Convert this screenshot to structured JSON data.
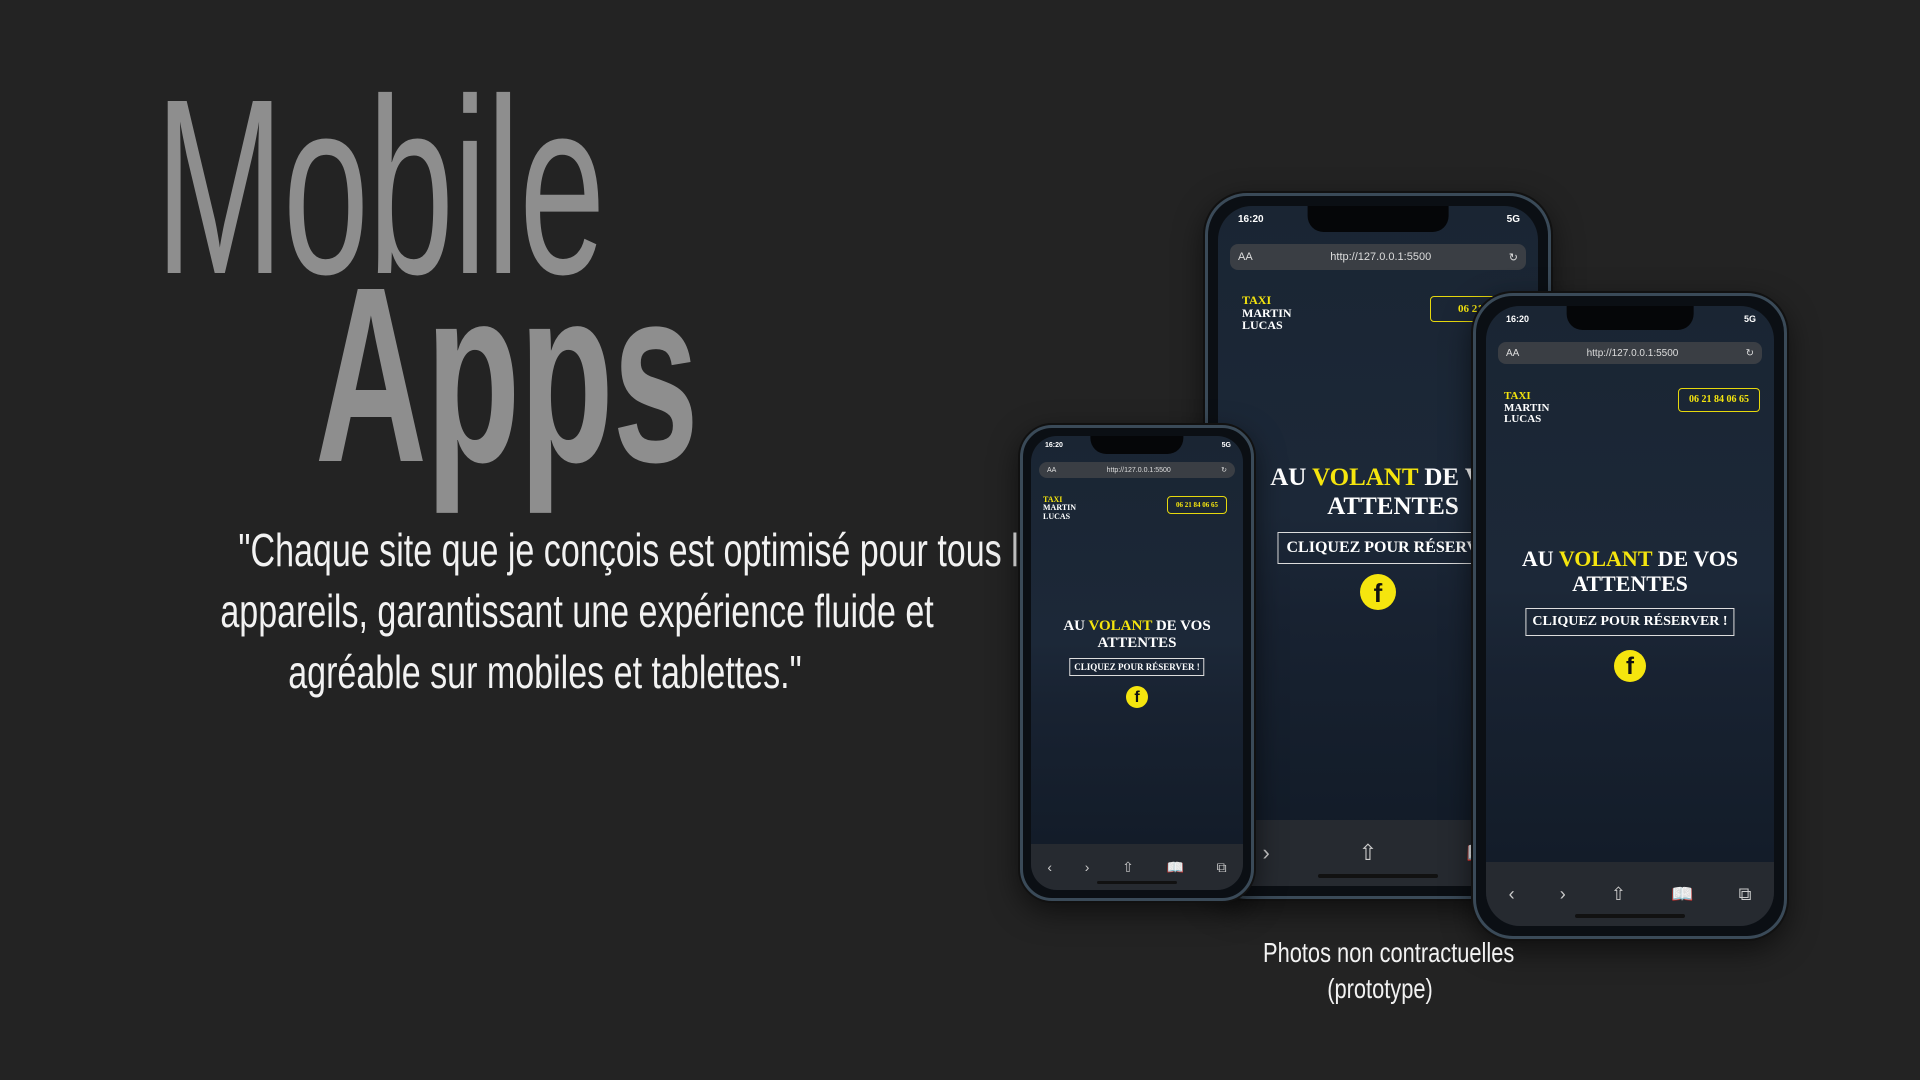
{
  "title": {
    "line1": "Mobile",
    "line2": "Apps"
  },
  "quote": {
    "line1": "\"Chaque site que je conçois est optimisé pour tous les",
    "line2": "appareils, garantissant une expérience fluide et",
    "line3": "agréable sur mobiles et tablettes.\""
  },
  "caption": {
    "line1": "Photos non contractuelles",
    "line2": "(prototype)"
  },
  "phone_ui": {
    "time": "16:20",
    "signal": "5G",
    "aa": "AA",
    "url": "http://127.0.0.1:5500",
    "brand_line1": "TAXI",
    "brand_line2": "MARTIN",
    "brand_line3": "LUCAS",
    "phone_number": "06 21 84 06 65",
    "headline_pre": "AU",
    "headline_accent": "VOLANT",
    "headline_post": "DE VOS",
    "headline_line2": "ATTENTES",
    "cta": "CLIQUEZ POUR RÉSERVER !",
    "fb": "f",
    "nav_back": "‹",
    "nav_forward": "›",
    "nav_share": "⇧",
    "nav_bookmarks": "📖",
    "nav_tabs": "⧉",
    "reload": "↻",
    "lock": "🔒"
  },
  "colors": {
    "background": "#232323",
    "title": "#8e8e8e",
    "accent": "#f5e50e"
  }
}
